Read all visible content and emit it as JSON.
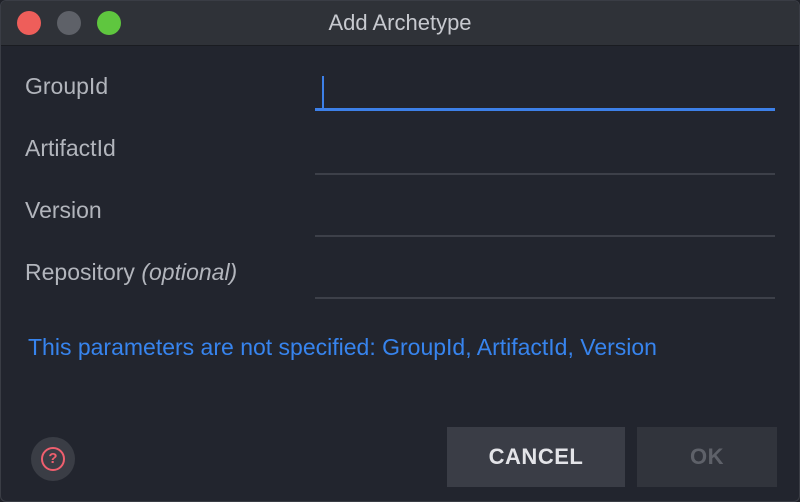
{
  "window": {
    "title": "Add Archetype",
    "controls": {
      "close": "close-icon",
      "minimize": "minimize-icon",
      "maximize": "maximize-icon"
    }
  },
  "form": {
    "fields": [
      {
        "label": "GroupId",
        "value": "",
        "focused": true
      },
      {
        "label": "ArtifactId",
        "value": ""
      },
      {
        "label": "Version",
        "value": ""
      },
      {
        "label": "Repository",
        "label_suffix": "(optional)",
        "value": ""
      }
    ]
  },
  "error_message": "This parameters are not specified: GroupId, ArtifactId, Version",
  "footer": {
    "help_icon_text": "?",
    "cancel_label": "CANCEL",
    "ok_label": "OK"
  },
  "colors": {
    "accent": "#3d80e8",
    "error_text": "#3784ee",
    "close": "#ee5e5a",
    "maximize": "#5fc63f",
    "help": "#ef5f6e"
  }
}
